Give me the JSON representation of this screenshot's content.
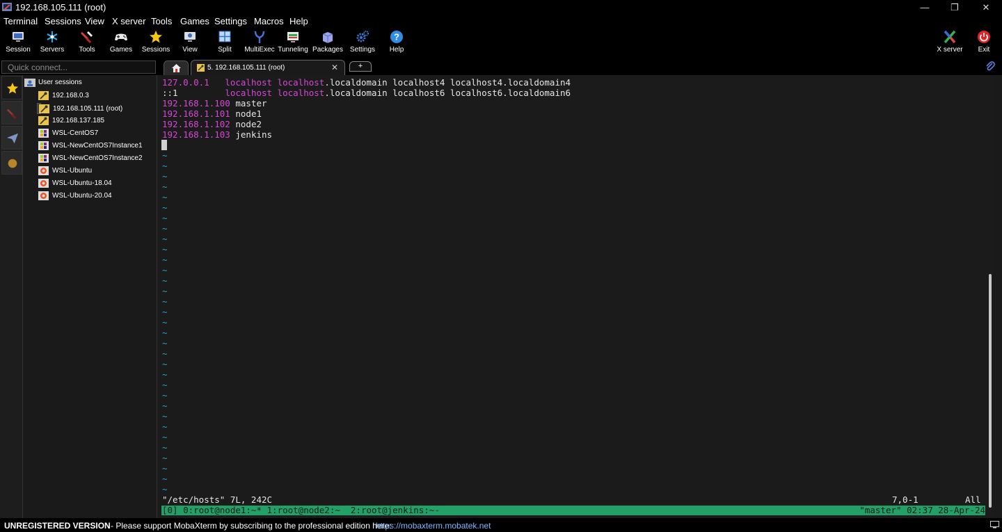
{
  "window": {
    "title": "192.168.105.111 (root)",
    "minimize": "—",
    "maximize": "❐",
    "close": "✕"
  },
  "menu": [
    "Terminal",
    "Sessions",
    "View",
    "X server",
    "Tools",
    "Games",
    "Settings",
    "Macros",
    "Help"
  ],
  "toolbar": {
    "items": [
      "Session",
      "Servers",
      "Tools",
      "Games",
      "Sessions",
      "View",
      "Split",
      "MultiExec",
      "Tunneling",
      "Packages",
      "Settings",
      "Help"
    ],
    "right_items": [
      "X server",
      "Exit"
    ]
  },
  "quick_connect": {
    "placeholder": "Quick connect..."
  },
  "tabs": {
    "session_tab_label": "5. 192.168.105.111 (root)",
    "close": "✕",
    "new_tab": "+"
  },
  "sessions": {
    "root_label": "User sessions",
    "items": [
      "192.168.0.3",
      "192.168.105.111 (root)",
      "192.168.137.185",
      "WSL-CentOS7",
      "WSL-NewCentOS7Instance1",
      "WSL-NewCentOS7Instance2",
      "WSL-Ubuntu",
      "WSL-Ubuntu-18.04",
      "WSL-Ubuntu-20.04"
    ],
    "selected_index": 1
  },
  "terminal": {
    "lines": [
      {
        "ip": "127.0.0.1",
        "gap": "   ",
        "mag1": "localhost",
        "sp": " ",
        "mag2": "localhost",
        "rest": ".localdomain localhost4 localhost4.localdomain4"
      },
      {
        "ip": "::1",
        "gap": "         ",
        "mag1": "localhost",
        "sp": " ",
        "mag2": "localhost",
        "rest": ".localdomain localhost6 localhost6.localdomain6"
      },
      {
        "ip": "192.168.1.100",
        "rest": " master"
      },
      {
        "ip": "192.168.1.101",
        "rest": " node1"
      },
      {
        "ip": "192.168.1.102",
        "rest": " node2"
      },
      {
        "ip": "192.168.1.103",
        "rest": " jenkins"
      }
    ],
    "tilde": "~",
    "tilde_count": 33,
    "vim_status": "\"/etc/hosts\" 7L, 242C",
    "vim_position": "7,0-1",
    "vim_scroll": "All",
    "tmux_left": "[0] 0:root@node1:~* 1:root@node2:~  2:root@jenkins:~-",
    "tmux_right": "\"master\" 02:37 28-Apr-24"
  },
  "status": {
    "unregistered": "UNREGISTERED VERSION",
    "message": "-  Please support MobaXterm by subscribing to the professional edition here:",
    "link": "https://mobaxterm.mobatek.net"
  }
}
